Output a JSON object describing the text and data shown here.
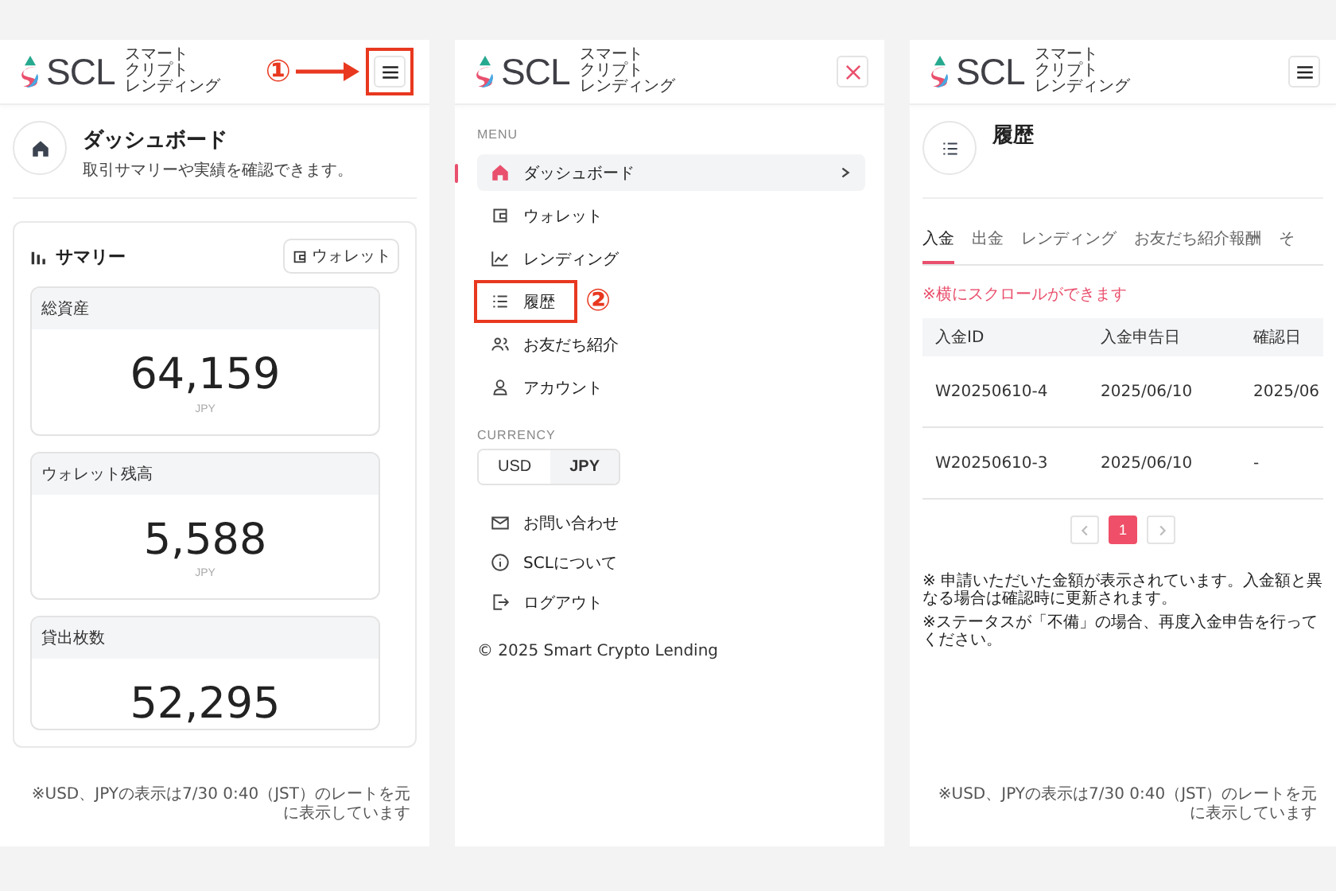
{
  "panels": [
    {
      "kind": "dashboard",
      "header": {
        "logo": {
          "mark": "SCL",
          "tagline": [
            "スマート",
            "クリプト",
            "レンディング"
          ]
        },
        "button": {
          "kind": "menu"
        },
        "annotation": "①"
      },
      "page": {
        "title": "ダッシュボード",
        "subtitle": "取引サマリーや実績を確認できます。"
      },
      "summary": {
        "title": "サマリー",
        "button": "ウォレット",
        "stats": [
          {
            "label": "総資産",
            "value": "64,159",
            "unit": "JPY"
          },
          {
            "label": "ウォレット残高",
            "value": "5,588",
            "unit": "JPY"
          },
          {
            "label": "貸出枚数",
            "value": "52,295"
          }
        ]
      },
      "footnote": "※USD、JPYの表示は7/30 0:40（JST）のレートを元に表示しています"
    },
    {
      "kind": "menu",
      "header": {
        "logo": {
          "mark": "SCL",
          "tagline": [
            "スマート",
            "クリプト",
            "レンディング"
          ]
        },
        "button": {
          "kind": "close"
        }
      },
      "menu_label": "MENU",
      "items": [
        {
          "label": "ダッシュボード",
          "selected": true
        },
        {
          "label": "ウォレット",
          "selected": false
        },
        {
          "label": "レンディング",
          "selected": false
        },
        {
          "label": "履歴",
          "selected": false,
          "annotation": "②"
        },
        {
          "label": "お友だち紹介",
          "selected": false
        },
        {
          "label": "アカウント",
          "selected": false
        }
      ],
      "currency_label": "CURRENCY",
      "currencies": [
        {
          "label": "USD",
          "selected": false
        },
        {
          "label": "JPY",
          "selected": true
        }
      ],
      "links": [
        "お問い合わせ",
        "SCLについて",
        "ログアウト"
      ],
      "copyright": "© 2025 Smart Crypto Lending"
    },
    {
      "kind": "history",
      "header": {
        "logo": {
          "mark": "SCL",
          "tagline": [
            "スマート",
            "クリプト",
            "レンディング"
          ]
        },
        "button": {
          "kind": "menu"
        }
      },
      "page": {
        "title": "履歴"
      },
      "tabs": [
        {
          "label": "入金",
          "selected": true
        },
        {
          "label": "出金",
          "selected": false
        },
        {
          "label": "レンディング",
          "selected": false
        },
        {
          "label": "お友だち紹介報酬",
          "selected": false
        },
        {
          "label": "そ",
          "selected": false
        }
      ],
      "scroll_hint": "※横にスクロールができます",
      "table": {
        "columns": [
          "入金ID",
          "入金申告日",
          "確認日"
        ],
        "rows": [
          [
            "W20250610-4",
            "2025/06/10",
            "2025/06"
          ],
          [
            "W20250610-3",
            "2025/06/10",
            "-"
          ]
        ]
      },
      "pagination": {
        "pages": [
          {
            "label": "1",
            "selected": true
          }
        ]
      },
      "notes": [
        "※ 申請いただいた金額が表示されています。入金額と異なる場合は確認時に更新されます。",
        "※ステータスが「不備」の場合、再度入金申告を行ってください。"
      ],
      "footnote": "※USD、JPYの表示は7/30 0:40（JST）のレートを元に表示しています"
    }
  ]
}
